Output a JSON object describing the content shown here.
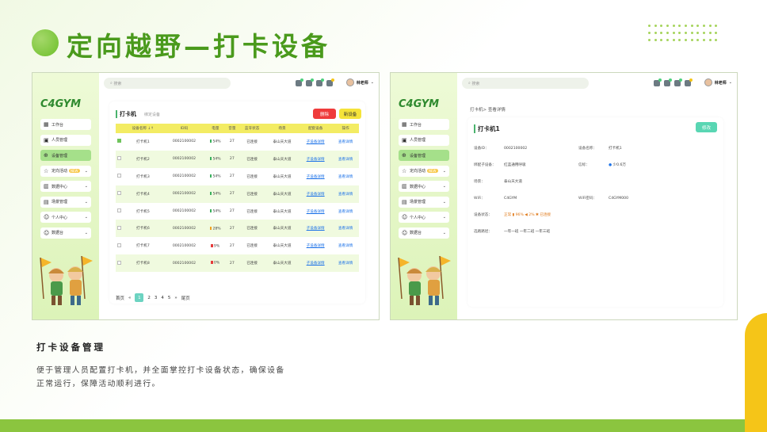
{
  "slide": {
    "title": "定向越野—打卡设备",
    "section_heading": "打卡设备管理",
    "description": "便于管理人员配置打卡机，并全面掌控打卡设备状态，确保设备正常运行，保障活动顺利进行。"
  },
  "colors": {
    "brand_green": "#4a9a1c",
    "accent_yellow": "#f5c518",
    "delete_red": "#ef3b3b"
  },
  "app": {
    "logo": "C4GYM",
    "search_placeholder": "搜索",
    "user_name": "林老师",
    "menu": [
      {
        "label": "工作台",
        "icon": "dashboard-icon"
      },
      {
        "label": "人员管理",
        "icon": "person-card-icon"
      },
      {
        "label": "设备管理",
        "icon": "device-search-icon",
        "active": true
      },
      {
        "label": "定向活动",
        "icon": "star-icon",
        "badge": "NEW"
      },
      {
        "label": "数据中心",
        "icon": "bar-chart-icon"
      },
      {
        "label": "场景管理",
        "icon": "scene-icon"
      },
      {
        "label": "个人中心",
        "icon": "user-icon"
      },
      {
        "label": "数据台",
        "icon": "user-icon"
      }
    ]
  },
  "list_page": {
    "title": "打卡机",
    "tip": "绑定设备",
    "delete_label": "删除",
    "add_label": "新设备",
    "columns": [
      "设备名称 ↓↑",
      "ID码",
      "电量",
      "音量",
      "蓝牙状态",
      "场景",
      "配套设备",
      "操作"
    ],
    "rows": [
      {
        "name": "打卡机1",
        "id": "0002100002",
        "battery": "54%",
        "volume": "27",
        "bt": "已连接",
        "scene": "泰山天大道",
        "sub": "子设备详情",
        "op": "查看详情",
        "checked": true
      },
      {
        "name": "打卡机2",
        "id": "0002100002",
        "battery": "54%",
        "volume": "27",
        "bt": "已连接",
        "scene": "泰山天大道",
        "sub": "子设备详情",
        "op": "查看详情"
      },
      {
        "name": "打卡机3",
        "id": "0002100002",
        "battery": "54%",
        "volume": "27",
        "bt": "已连接",
        "scene": "泰山天大道",
        "sub": "子设备详情",
        "op": "查看详情"
      },
      {
        "name": "打卡机4",
        "id": "0002100002",
        "battery": "54%",
        "volume": "27",
        "bt": "已连接",
        "scene": "泰山天大道",
        "sub": "子设备详情",
        "op": "查看详情"
      },
      {
        "name": "打卡机5",
        "id": "0002100002",
        "battery": "54%",
        "volume": "27",
        "bt": "已连接",
        "scene": "泰山天大道",
        "sub": "子设备详情",
        "op": "查看详情"
      },
      {
        "name": "打卡机6",
        "id": "0002100002",
        "battery": "28%",
        "volume": "27",
        "bt": "已连接",
        "scene": "泰山天大道",
        "sub": "子设备详情",
        "op": "查看详情"
      },
      {
        "name": "打卡机7",
        "id": "0002100002",
        "battery": "9%",
        "volume": "27",
        "bt": "已连接",
        "scene": "泰山天大道",
        "sub": "子设备详情",
        "op": "查看详情"
      },
      {
        "name": "打卡机8",
        "id": "0002100002",
        "battery": "0%",
        "volume": "27",
        "bt": "已连接",
        "scene": "泰山天大道",
        "sub": "子设备详情",
        "op": "查看详情"
      }
    ],
    "pager": {
      "first": "首页",
      "prev": "«",
      "pages": [
        "1",
        "2",
        "3",
        "4",
        "5"
      ],
      "next": "»",
      "last": "尾页"
    }
  },
  "detail_page": {
    "breadcrumb": "打卡机> 查看详情",
    "title": "打卡机1",
    "edit_label": "修改",
    "fields": {
      "device_id_k": "设备ID：",
      "device_id_v": "0002100002",
      "device_name_k": "设备名称：",
      "device_name_v": "打卡机1",
      "sub_k": "绑配子设备：",
      "sub_v": "红蓝通用呼吸",
      "bt_k": "信标：",
      "bt_v": "少0.6万",
      "scene_k": "场景：",
      "scene_v": "泰山天大道",
      "wifi_k": "WiFi：",
      "wifi_v": "C4GYM",
      "wifi_pw_k": "WiFi密码：",
      "wifi_pw_v": "C4GYM000",
      "status_k": "设备状态：",
      "status_v": "正常  ▮ 96%  ◀ 2%  ✱ 已连接",
      "route_k": "选路路径：",
      "route_v": "一年一班    一年二班    一年三班"
    }
  }
}
